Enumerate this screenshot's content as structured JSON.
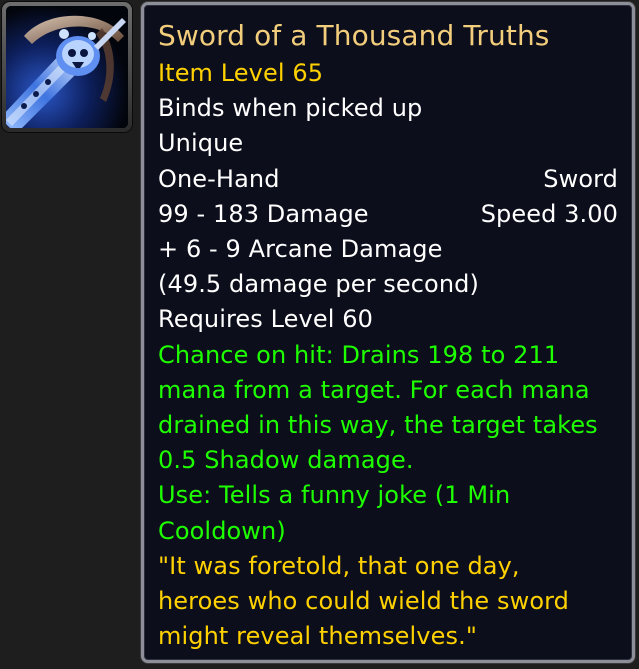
{
  "item": {
    "icon": "sword-item-icon",
    "name": "Sword of a Thousand Truths",
    "item_level": "Item Level 65",
    "binding": "Binds when picked up",
    "uniqueness": "Unique",
    "slot": "One-Hand",
    "weapon_type": "Sword",
    "damage": "99 - 183 Damage",
    "speed": "Speed 3.00",
    "bonus_damage": "+ 6 - 9 Arcane Damage",
    "dps": "(49.5 damage per second)",
    "requirement": "Requires Level 60",
    "effects": {
      "chance_on_hit": [
        "Chance on hit: Drains 198 to 211",
        "mana from a target. For each mana",
        "drained in this way, the target takes",
        "0.5 Shadow damage."
      ],
      "use": [
        "Use: Tells a funny joke (1 Min",
        "Cooldown)"
      ]
    },
    "flavor_text": [
      "\"It was foretold, that one day,",
      "heroes who could wield the sword",
      "might reveal themselves.\""
    ]
  },
  "colors": {
    "title": "#f2cd7c",
    "item_level": "#ffd100",
    "stats": "#ffffff",
    "effects": "#1eff00",
    "flavor": "#ffd100"
  }
}
